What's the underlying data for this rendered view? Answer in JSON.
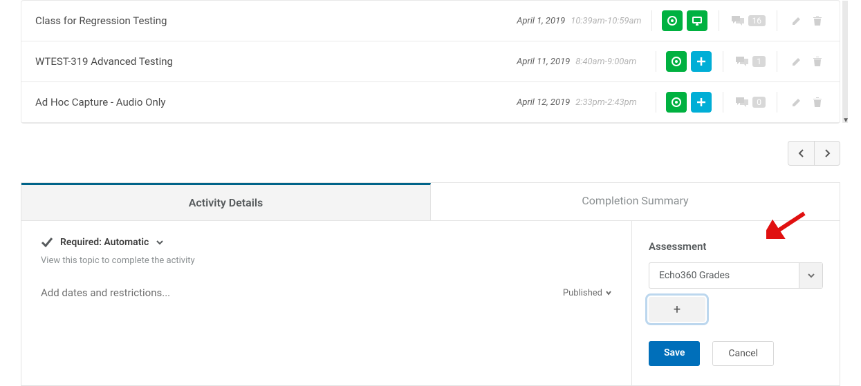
{
  "classes": [
    {
      "title": "Class for Regression Testing",
      "date": "April 1, 2019",
      "time": "10:39am-10:59am",
      "comments": "16",
      "second_icon": "present-icon"
    },
    {
      "title": "WTEST-319 Advanced Testing",
      "date": "April 11, 2019",
      "time": "8:40am-9:00am",
      "comments": "1",
      "second_icon": "plus-icon"
    },
    {
      "title": "Ad Hoc Capture - Audio Only",
      "date": "April 12, 2019",
      "time": "2:33pm-2:43pm",
      "comments": "0",
      "second_icon": "plus-icon"
    }
  ],
  "tabs": {
    "details": "Activity Details",
    "summary": "Completion Summary"
  },
  "required": {
    "label": "Required: Automatic",
    "sub": "View this topic to complete the activity"
  },
  "dates_link": "Add dates and restrictions...",
  "published_label": "Published",
  "assessment": {
    "heading": "Assessment",
    "selected": "Echo360 Grades",
    "save": "Save",
    "cancel": "Cancel"
  }
}
